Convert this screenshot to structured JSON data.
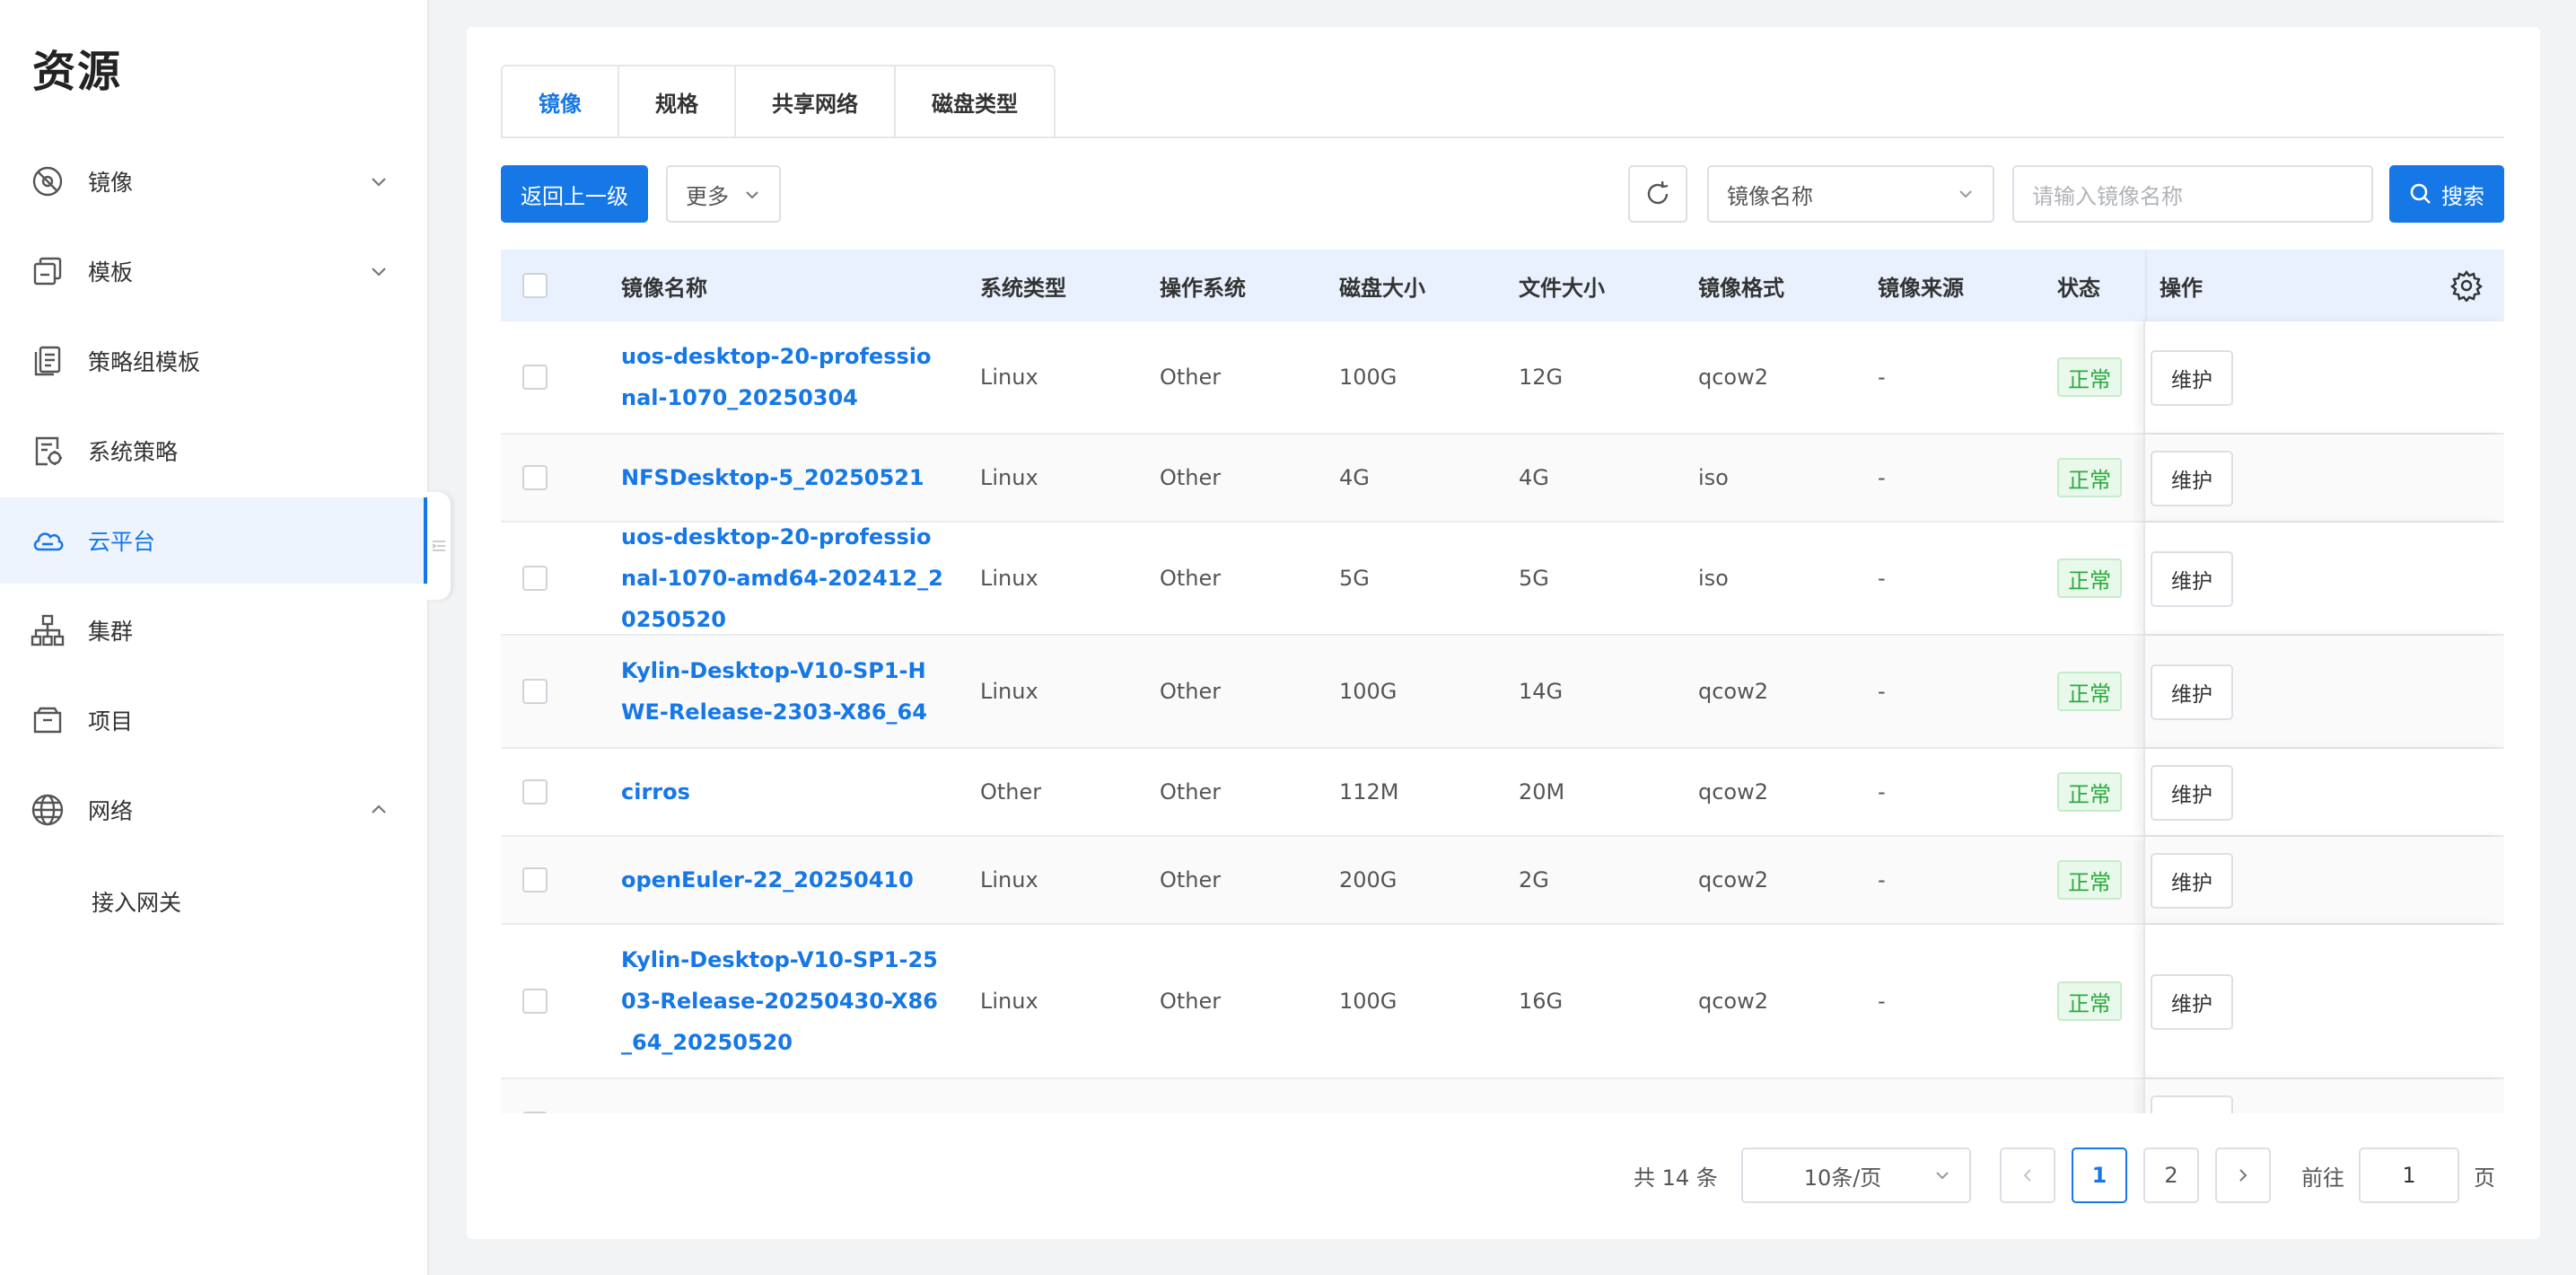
{
  "sidebar": {
    "title": "资源",
    "items": [
      {
        "label": "镜像",
        "icon": "image-disc-icon",
        "chevron": "down"
      },
      {
        "label": "模板",
        "icon": "template-icon",
        "chevron": "down"
      },
      {
        "label": "策略组模板",
        "icon": "policy-group-icon"
      },
      {
        "label": "系统策略",
        "icon": "system-policy-icon"
      },
      {
        "label": "云平台",
        "icon": "cloud-icon",
        "active": true
      },
      {
        "label": "集群",
        "icon": "cluster-icon"
      },
      {
        "label": "项目",
        "icon": "project-icon"
      },
      {
        "label": "网络",
        "icon": "globe-icon",
        "chevron": "up"
      }
    ],
    "sub_items": [
      "接入网关"
    ]
  },
  "tabs": [
    "镜像",
    "规格",
    "共享网络",
    "磁盘类型"
  ],
  "toolbar": {
    "back_label": "返回上一级",
    "more_label": "更多",
    "filter_field": "镜像名称",
    "search_placeholder": "请输入镜像名称",
    "search_label": "搜索"
  },
  "table": {
    "headers": [
      "镜像名称",
      "系统类型",
      "操作系统",
      "磁盘大小",
      "文件大小",
      "镜像格式",
      "镜像来源",
      "状态",
      "操作"
    ],
    "action_label": "维护",
    "rows": [
      {
        "name": "uos-desktop-20-professional-1070_20250304",
        "sys_type": "Linux",
        "os": "Other",
        "disk": "100G",
        "file": "12G",
        "format": "qcow2",
        "source": "-",
        "status": "正常"
      },
      {
        "name": "NFSDesktop-5_20250521",
        "sys_type": "Linux",
        "os": "Other",
        "disk": "4G",
        "file": "4G",
        "format": "iso",
        "source": "-",
        "status": "正常"
      },
      {
        "name": "uos-desktop-20-professional-1070-amd64-202412_20250520",
        "sys_type": "Linux",
        "os": "Other",
        "disk": "5G",
        "file": "5G",
        "format": "iso",
        "source": "-",
        "status": "正常"
      },
      {
        "name": "Kylin-Desktop-V10-SP1-HWE-Release-2303-X86_64",
        "sys_type": "Linux",
        "os": "Other",
        "disk": "100G",
        "file": "14G",
        "format": "qcow2",
        "source": "-",
        "status": "正常"
      },
      {
        "name": "cirros",
        "sys_type": "Other",
        "os": "Other",
        "disk": "112M",
        "file": "20M",
        "format": "qcow2",
        "source": "-",
        "status": "正常"
      },
      {
        "name": "openEuler-22_20250410",
        "sys_type": "Linux",
        "os": "Other",
        "disk": "200G",
        "file": "2G",
        "format": "qcow2",
        "source": "-",
        "status": "正常"
      },
      {
        "name": "Kylin-Desktop-V10-SP1-2503-Release-20250430-X86_64_20250520",
        "sys_type": "Linux",
        "os": "Other",
        "disk": "100G",
        "file": "16G",
        "format": "qcow2",
        "source": "-",
        "status": "正常"
      }
    ]
  },
  "pagination": {
    "total": "共 14 条",
    "page_size": "10条/页",
    "pages": [
      "1",
      "2"
    ],
    "current": "1",
    "goto_label": "前往",
    "goto_value": "1",
    "page_suffix": "页"
  },
  "colors": {
    "accent": "#1677e6",
    "status_green": "#2eaa3f",
    "header_bg": "#e8f1fd"
  }
}
